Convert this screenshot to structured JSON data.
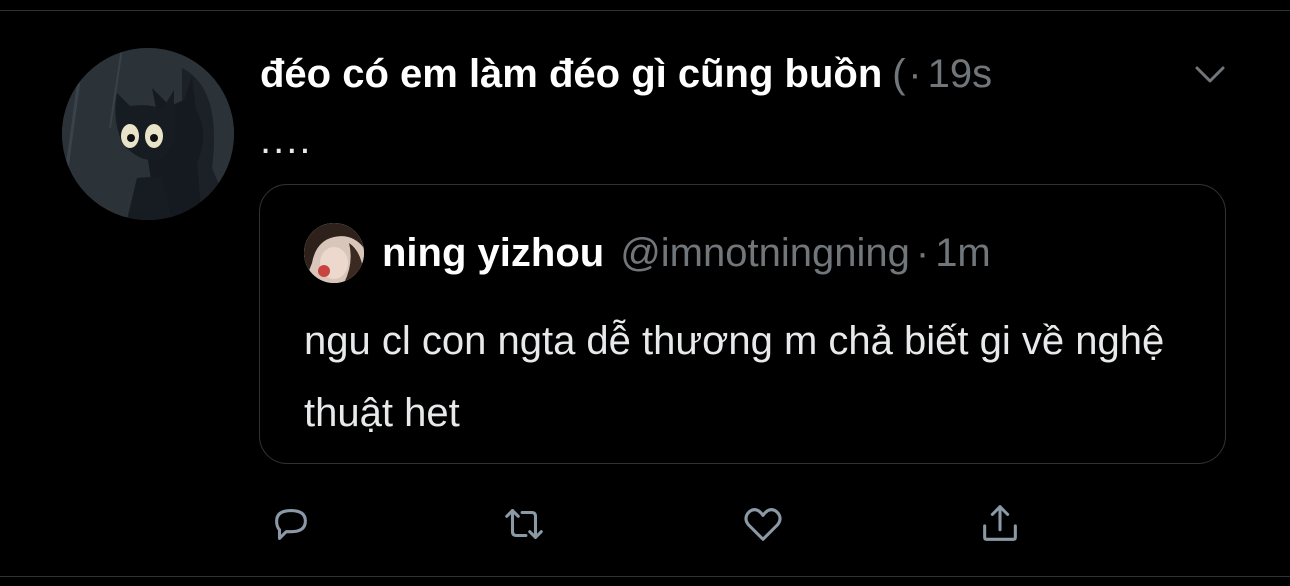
{
  "tweet": {
    "display_name": "đéo có em làm đéo gì cũng buồn",
    "handle_truncated": "(",
    "separator": "·",
    "time": "19s",
    "text": "...."
  },
  "quoted_tweet": {
    "display_name": "ning yizhou",
    "handle": "@imnotningning",
    "separator": "·",
    "time": "1m",
    "text": "ngu cl con ngta dễ thương m chả biết gi về nghệ thuật het"
  },
  "icons": [
    "avatar",
    "more-caret-icon",
    "reply-icon",
    "retweet-icon",
    "like-icon",
    "share-icon"
  ],
  "colors": {
    "background": "#000000",
    "text": "#e7e9ea",
    "secondary_text": "#71767b",
    "border": "#2f3336"
  }
}
